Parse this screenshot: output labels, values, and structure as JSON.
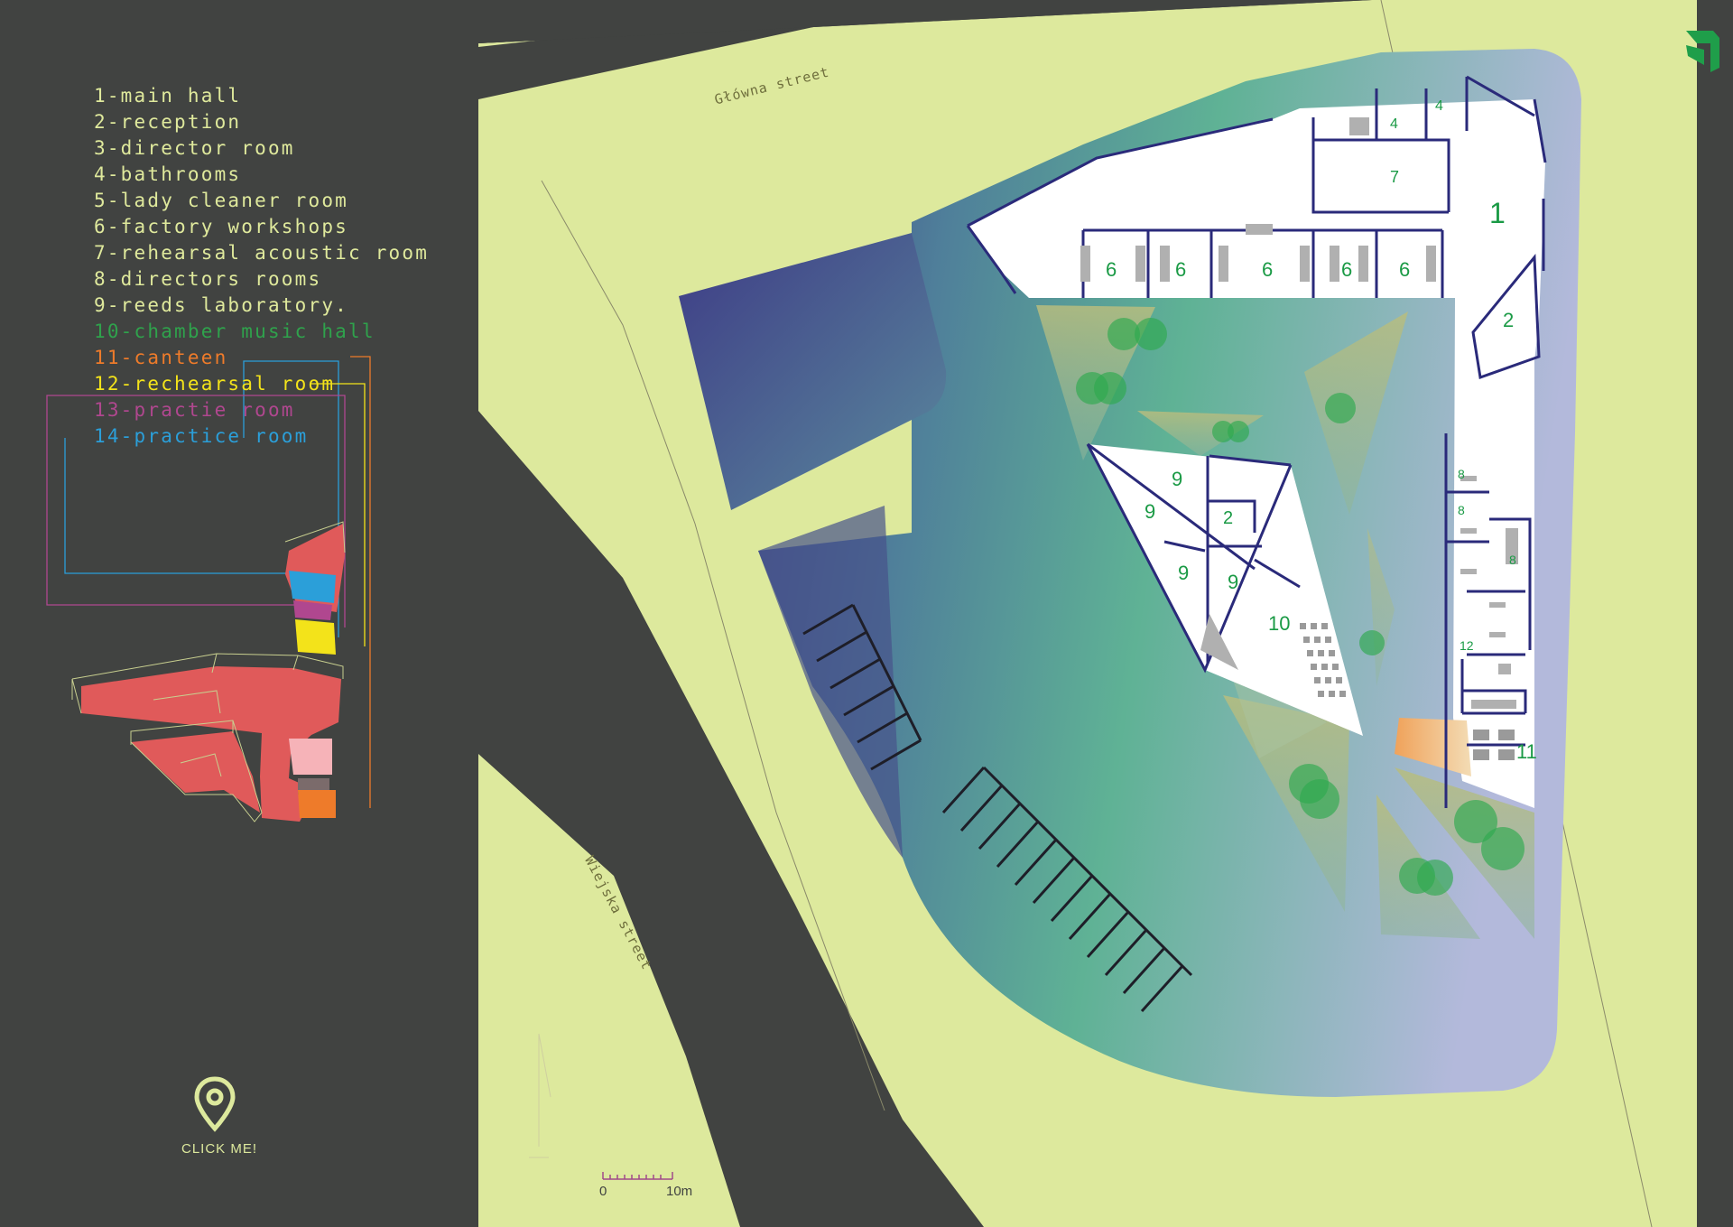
{
  "legend": [
    {
      "label": "1-main hall",
      "color": "#dfe99c"
    },
    {
      "label": "2-reception",
      "color": "#dfe99c"
    },
    {
      "label": "3-director room",
      "color": "#dfe99c"
    },
    {
      "label": "4-bathrooms",
      "color": "#dfe99c"
    },
    {
      "label": "5-lady cleaner room",
      "color": "#dfe99c"
    },
    {
      "label": "6-factory workshops",
      "color": "#dfe99c"
    },
    {
      "label": "7-rehearsal acoustic room",
      "color": "#dfe99c"
    },
    {
      "label": "8-directors rooms",
      "color": "#dfe99c"
    },
    {
      "label": "9-reeds laboratory.",
      "color": "#dfe99c"
    },
    {
      "label": "10-chamber music hall",
      "color": "#2fa24c"
    },
    {
      "label": "11-canteen",
      "color": "#ee7b2a"
    },
    {
      "label": "12-rechearsal room",
      "color": "#f3e31a"
    },
    {
      "label": "13-practie room",
      "color": "#b0478f"
    },
    {
      "label": "14-practice room",
      "color": "#2b9fd9"
    }
  ],
  "streets": {
    "glowna": "Główna street",
    "wiejska": "Wiejska street"
  },
  "rooms": {
    "r1": "1",
    "r2": "2",
    "r2b": "2",
    "r4": "4",
    "r7": "7",
    "r6": "6",
    "r8": "8",
    "r9": "9",
    "r10": "10",
    "r11": "11",
    "r12": "12"
  },
  "scale": {
    "start": "0",
    "end": "10m"
  },
  "click_me": "CLICK ME!",
  "icons": {
    "pin": "location-pin-icon",
    "logo": "logo-icon",
    "north": "north-arrow-icon"
  },
  "colors": {
    "background": "#414341",
    "road_edge": "#dde99d",
    "site_green": "#5fb09a",
    "building": "#ffffff",
    "walls": "#2a2a7a",
    "room_labels": "#1a9a45",
    "trees": "#2ea94e",
    "axo_red": "#e05a5a"
  }
}
